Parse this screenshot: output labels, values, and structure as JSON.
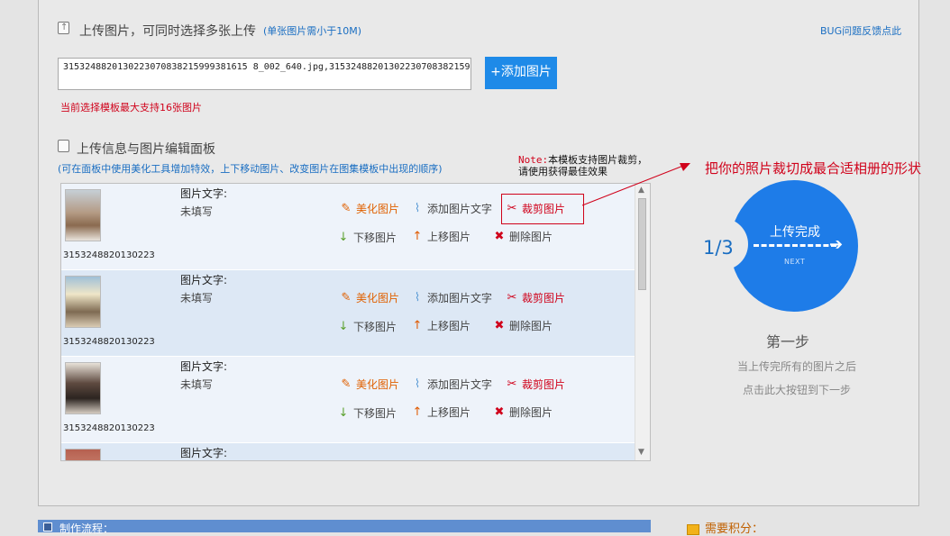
{
  "upload": {
    "title": "上传图片，可同时选择多张上传",
    "size_hint": "(单张图片需小于10M)",
    "bug_link": "BUG问题反馈点此",
    "file_value": "3153248820130223070838215999381615 8_002_640.jpg,3153248820130223070838215999",
    "add_button": "+添加图片",
    "limit_note": "当前选择模板最大支持16张图片"
  },
  "editor": {
    "title": "上传信息与图片编辑面板",
    "hint": "(可在面板中使用美化工具增加特效，上下移动图片、改变图片在图集模板中出现的顺序)"
  },
  "rows": [
    {
      "filename": "3153248820130223",
      "text_label": "图片文字:",
      "text_value": "未填写"
    },
    {
      "filename": "3153248820130223",
      "text_label": "图片文字:",
      "text_value": "未填写"
    },
    {
      "filename": "3153248820130223",
      "text_label": "图片文字:",
      "text_value": "未填写"
    },
    {
      "filename": "",
      "text_label": "图片文字:",
      "text_value": ""
    }
  ],
  "actions": {
    "beautify": "美化图片",
    "add_text": "添加图片文字",
    "crop": "裁剪图片",
    "move_down": "下移图片",
    "move_up": "上移图片",
    "delete": "删除图片"
  },
  "crop_note": {
    "prefix": "Note:",
    "line1": "本模板支持图片裁剪，",
    "line2": "请使用获得最佳效果"
  },
  "callout": "把你的照片裁切成最合适相册的形状",
  "progress": {
    "fraction": "1/3",
    "button_label": "上传完成",
    "next_label": "NEXT",
    "step_title": "第一步",
    "hint_line1": "当上传完所有的图片之后",
    "hint_line2": "点击此大按钮到下一步"
  },
  "footer": {
    "process_label": "制作流程：",
    "points_label": "需要积分："
  },
  "colors": {
    "accent_blue": "#1e7ce8",
    "alert_red": "#d0021b",
    "action_orange": "#e06000"
  }
}
